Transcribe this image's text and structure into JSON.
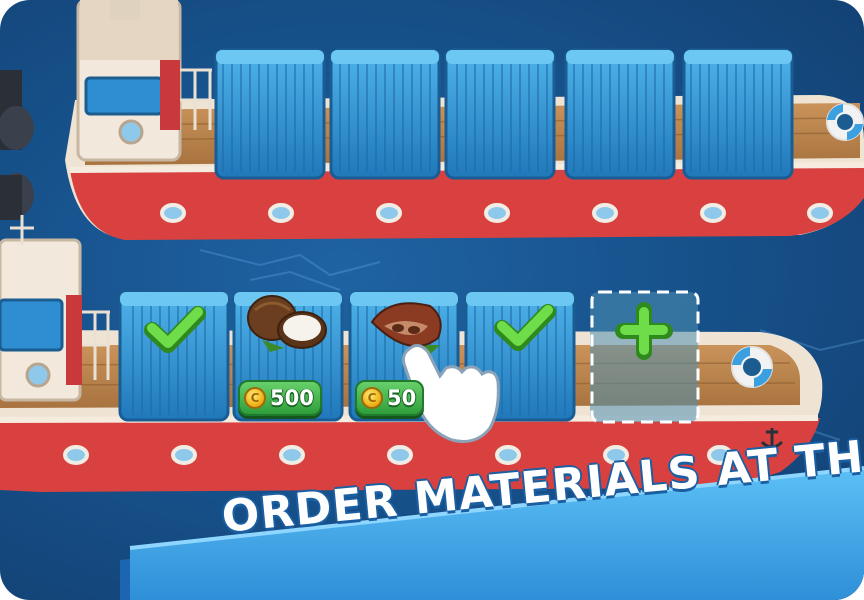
{
  "banner": {
    "text": "ORDER MATERIALS AT THE POR"
  },
  "bottom_ship": {
    "slots": [
      {
        "state": "done",
        "icon": "checkmark-icon"
      },
      {
        "state": "price",
        "icon": "coconut-icon",
        "price": "500"
      },
      {
        "state": "price",
        "icon": "cacao-pod-icon",
        "price": "50"
      },
      {
        "state": "done",
        "icon": "checkmark-icon"
      },
      {
        "state": "empty",
        "icon": "plus-icon"
      }
    ]
  },
  "top_ship": {
    "container_count": 5
  },
  "colors": {
    "sea": "#17528c",
    "hull_red": "#d8413f",
    "container_blue": "#2f90cf",
    "check_green": "#5cc93a",
    "banner_blue": "#3da4e6"
  }
}
